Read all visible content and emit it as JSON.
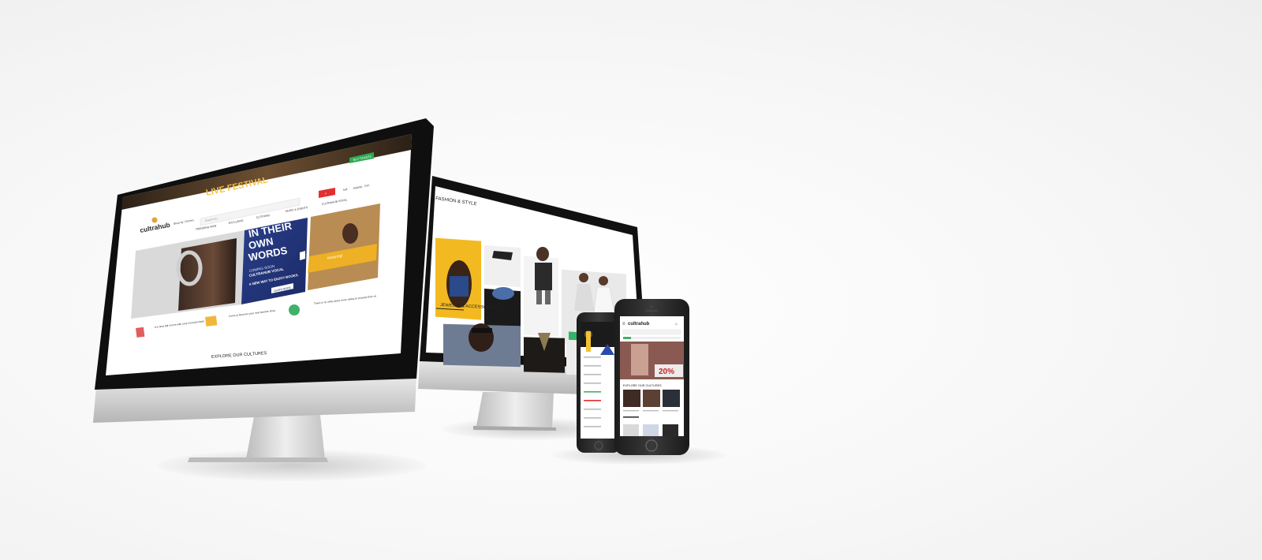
{
  "brand": "cultrahub",
  "imac": {
    "topbar_button": "BUY TICKETS",
    "promo_banner": "LIVE FESTIVAL",
    "header": {
      "links": [
        "Shop by: Genres",
        "Best Seller"
      ],
      "search_placeholder": "Search by...",
      "icons": [
        "Sell",
        "Wishlist",
        "Cart"
      ]
    },
    "nav": [
      "TRENDING NOW",
      "EXCLUSIVE",
      "CLOTHING",
      "MUSIC & EVENTS",
      "CULTRAHUB VOCAL"
    ],
    "hero": {
      "headline_lines": [
        "IN THEIR",
        "OWN",
        "WORDS"
      ],
      "sub_lines": [
        "COMING SOON",
        "CULTRAHUB VOCAL"
      ],
      "tagline": "A NEW WAY TO ENJOY BOOKS.",
      "cta": "LEARN MORE"
    },
    "side_promo": "Amazing!",
    "features": [
      "It is time fall in love with your next purchase",
      "Come & discover your next favorite shop.",
      "There is no other place more safety & securely than us"
    ],
    "section_title": "EXPLORE OUR CULTURES"
  },
  "second_monitor": {
    "section1": "FASHION & STYLE",
    "section2": "JEWELRY & ACCESSORIES"
  },
  "phone": {
    "badge": "20%",
    "section_title": "EXPLORE OUR CULTURES"
  }
}
